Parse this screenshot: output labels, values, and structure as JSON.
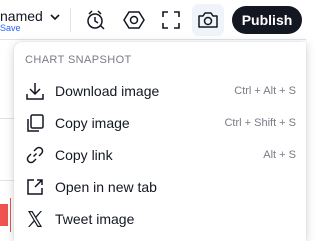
{
  "toolbar": {
    "layout_title": "named",
    "layout_subtitle": "Save",
    "publish_label": "Publish",
    "icons": [
      "chevron-down-icon",
      "alert-icon",
      "settings-hexagon-icon",
      "fullscreen-icon",
      "camera-icon"
    ]
  },
  "menu": {
    "section_title": "CHART SNAPSHOT",
    "items": [
      {
        "label": "Download image",
        "hotkey": "Ctrl + Alt + S",
        "icon": "download-icon"
      },
      {
        "label": "Copy image",
        "hotkey": "Ctrl + Shift + S",
        "icon": "copy-icon"
      },
      {
        "label": "Copy link",
        "hotkey": "Alt + S",
        "icon": "link-icon"
      },
      {
        "label": "Open in new tab",
        "hotkey": "",
        "icon": "open-new-tab-icon"
      },
      {
        "label": "Tweet image",
        "hotkey": "",
        "icon": "x-logo-icon"
      }
    ]
  },
  "colors": {
    "publish_bg": "#131722",
    "link_blue": "#2962ff",
    "muted_text": "#787b86",
    "candle_red": "#ef5350"
  }
}
